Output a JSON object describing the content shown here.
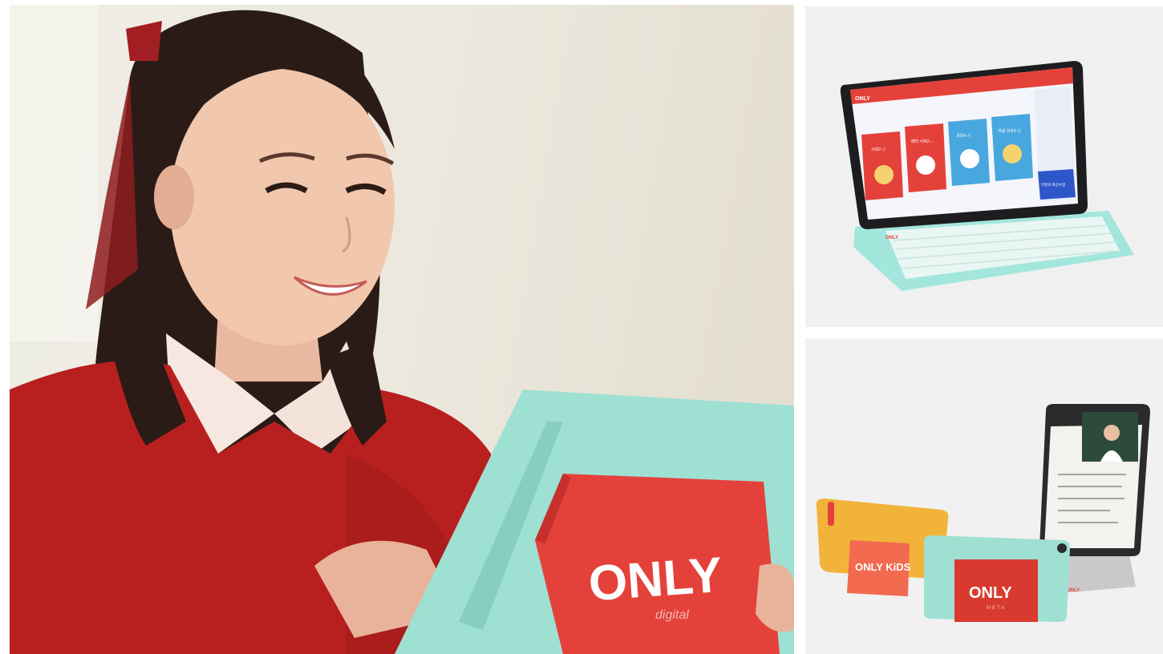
{
  "photo_main": {
    "tablet_logo": "ONLY",
    "tablet_sublogo": "digital"
  },
  "photo_laptop": {
    "screen_logo": "ONLY",
    "keyboard_logo": "ONLY",
    "screen_cards": [
      "사회2-①",
      "메타 사회2-...",
      "과학4-④",
      "개념 과학4-②"
    ],
    "screen_banner": "이달의 화상수업"
  },
  "photo_products": {
    "kids_logo": "ONLY KiDS",
    "meta_logo": "ONLY",
    "meta_sublogo": "META",
    "stand_logo": "ONLY"
  },
  "colors": {
    "brand_red": "#e5413b",
    "mint": "#9ee0d2",
    "yellow": "#f2b33a",
    "sweater_red": "#b8201f"
  }
}
